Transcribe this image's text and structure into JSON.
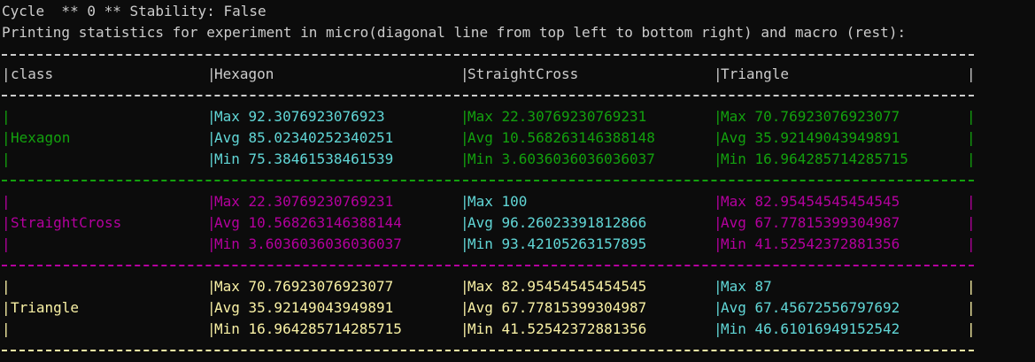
{
  "header": {
    "cycle_line": "Cycle  ** 0 ** Stability: False",
    "description_line": "Printing statistics for experiment in micro(diagonal line from top left to bottom right) and macro (rest):"
  },
  "table": {
    "headers": [
      "class",
      "Hexagon",
      "StraightCross",
      "Triangle"
    ],
    "rows": [
      {
        "class": "Hexagon",
        "cells": [
          [
            "Max 92.3076923076923",
            "Avg 85.02340252340251",
            "Min 75.38461538461539"
          ],
          [
            "Max 22.30769230769231",
            "Avg 10.568263146388148",
            "Min 3.6036036036036037"
          ],
          [
            "Max 70.76923076923077",
            "Avg 35.92149043949891",
            "Min 16.964285714285715"
          ]
        ]
      },
      {
        "class": "StraightCross",
        "cells": [
          [
            "Max 22.30769230769231",
            "Avg 10.568263146388144",
            "Min 3.6036036036036037"
          ],
          [
            "Max 100",
            "Avg 96.26023391812866",
            "Min 93.42105263157895"
          ],
          [
            "Max 82.95454545454545",
            "Avg 67.77815399304987",
            "Min 41.52542372881356"
          ]
        ]
      },
      {
        "class": "Triangle",
        "cells": [
          [
            "Max 70.76923076923077",
            "Avg 35.92149043949891",
            "Min 16.964285714285715"
          ],
          [
            "Max 82.95454545454545",
            "Avg 67.77815399304987",
            "Min 41.52542372881356"
          ],
          [
            "Max 87",
            "Avg 67.45672556797692",
            "Min 46.61016949152542"
          ]
        ]
      }
    ]
  },
  "colors": {
    "background": "#0c0c0c",
    "text": "#cccccc",
    "green": "#13a10e",
    "magenta": "#b4009e",
    "cyan": "#61d6d6",
    "yellow": "#f9f1a5"
  }
}
